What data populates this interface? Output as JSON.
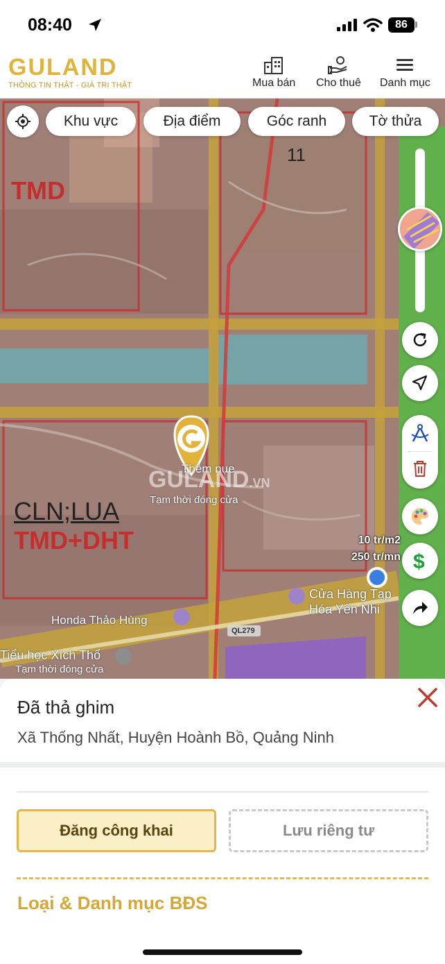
{
  "status_bar": {
    "time": "08:40",
    "battery": "86"
  },
  "header": {
    "logo_text": "GULAND",
    "logo_tagline": "THÔNG TIN THẬT - GIÁ TRỊ THẬT",
    "nav": [
      {
        "label": "Mua bán",
        "icon": "building-icon"
      },
      {
        "label": "Cho thuê",
        "icon": "hand-person-icon"
      },
      {
        "label": "Danh mục",
        "icon": "menu-icon"
      }
    ]
  },
  "filters": [
    "Khu vực",
    "Địa điểm",
    "Góc ranh",
    "Tờ thửa"
  ],
  "map": {
    "zone_labels": {
      "top_left": "TMD",
      "top_mid": "11",
      "mid_left_1": "CLN;LUA",
      "mid_left_2": "TMD+DHT"
    },
    "places": {
      "them_nue": "Thêm nụe",
      "temp_closed_1": "Tạm thời đóng cửa",
      "watermark": "GULAND",
      "watermark_suffix": ".VN",
      "honda": "Honda Thảo Hùng",
      "shop_line1": "Cửa Hàng Tạp",
      "shop_line2": "Hóa Yến Nhi",
      "school": "Tiểu học Xích Thổ",
      "temp_closed_2": "Tạm thời đóng cửa",
      "road": "QL279"
    },
    "prices": {
      "per_m2": "10 tr/m2",
      "per_front": "250 tr/mn"
    }
  },
  "bottom_sheet": {
    "title": "Đã thả ghim",
    "address": "Xã Thống Nhất, Huyện Hoành Bồ, Quảng Ninh",
    "public_button": "Đăng công khai",
    "private_button": "Lưu riêng tư",
    "section_title": "Loại & Danh mục BĐS"
  },
  "colors": {
    "brand": "#e2b33a",
    "accent_dark": "#d6a636",
    "danger": "#c0392b",
    "zone_red": "#c42e2e"
  }
}
